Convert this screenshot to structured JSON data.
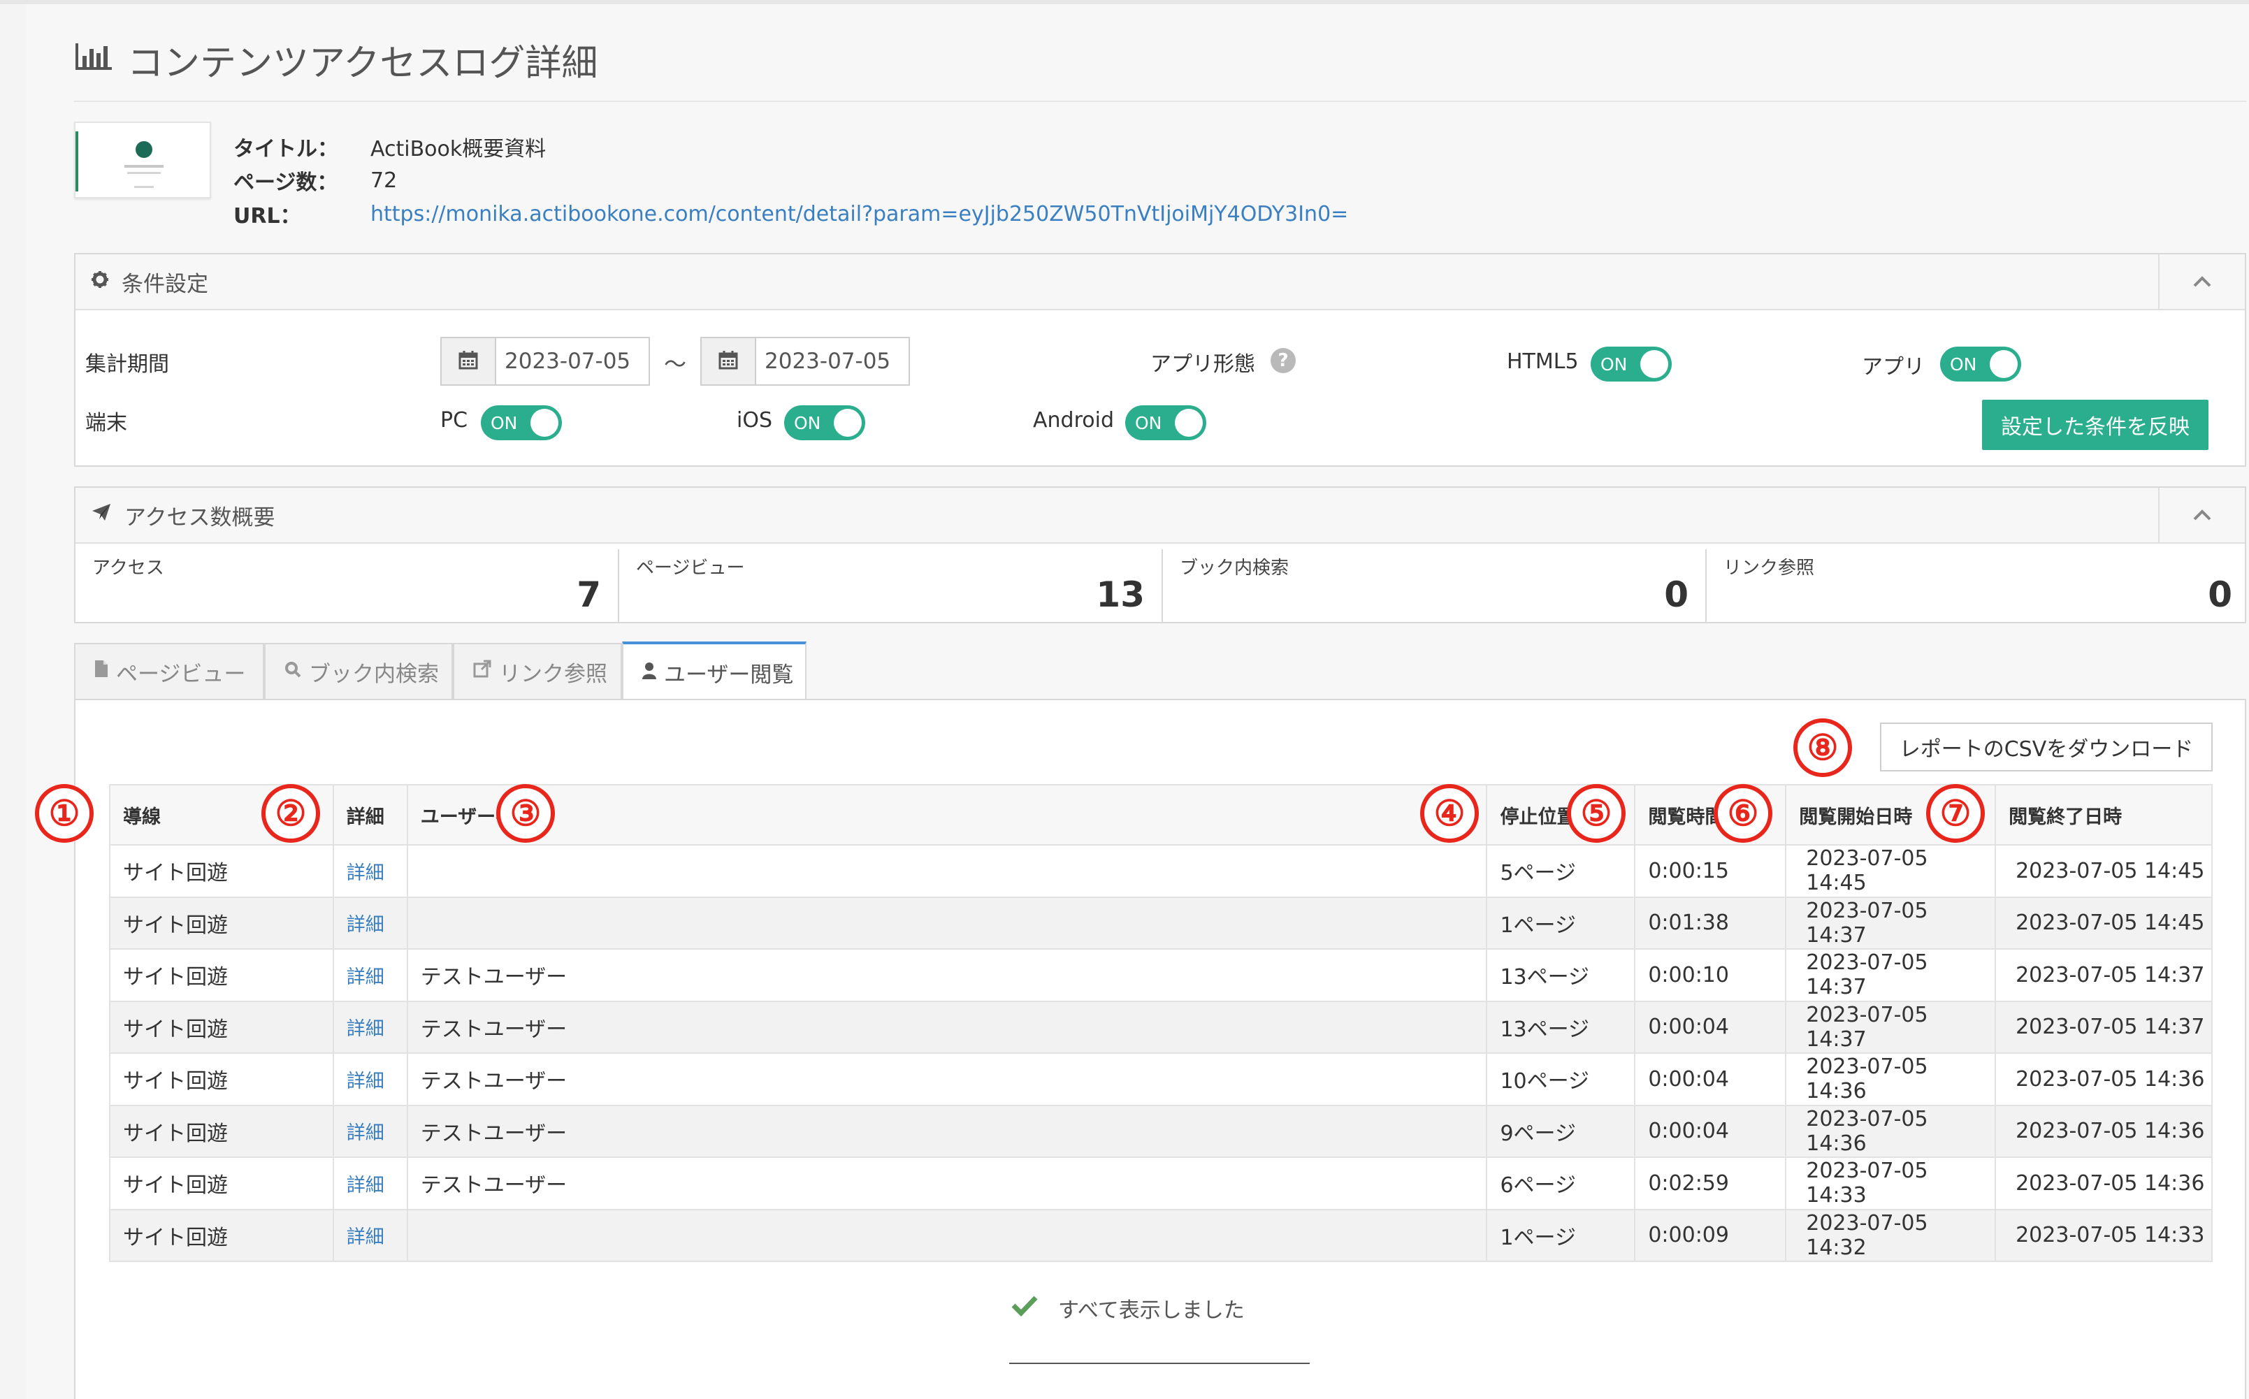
{
  "page": {
    "title": "コンテンツアクセスログ詳細"
  },
  "content_info": {
    "title_label": "タイトル：",
    "title_value": "ActiBook概要資料",
    "pages_label": "ページ数：",
    "pages_value": "72",
    "url_label": "URL：",
    "url_value": "https://monika.actibookone.com/content/detail?param=eyJjb250ZW50TnVtIjoiMjY4ODY3In0="
  },
  "conditions": {
    "header": "条件設定",
    "period_label": "集計期間",
    "date_from": "2023-07-05",
    "tilde": "～",
    "date_to": "2023-07-05",
    "app_form_label": "アプリ形態",
    "html5_label": "HTML5",
    "app_label": "アプリ",
    "device_label": "端末",
    "pc_label": "PC",
    "ios_label": "iOS",
    "android_label": "Android",
    "toggle_on": "ON",
    "apply_button": "設定した条件を反映"
  },
  "summary": {
    "header": "アクセス数概要",
    "stats": [
      {
        "label": "アクセス",
        "value": "7"
      },
      {
        "label": "ページビュー",
        "value": "13"
      },
      {
        "label": "ブック内検索",
        "value": "0"
      },
      {
        "label": "リンク参照",
        "value": "0"
      }
    ]
  },
  "tabs": [
    {
      "label": "ページビュー",
      "icon": "file-icon"
    },
    {
      "label": "ブック内検索",
      "icon": "search-icon"
    },
    {
      "label": "リンク参照",
      "icon": "external-link-icon"
    },
    {
      "label": "ユーザー閲覧",
      "icon": "user-icon",
      "active": true
    }
  ],
  "csv_button": "レポートのCSVをダウンロード",
  "table": {
    "columns": [
      "導線",
      "詳細",
      "ユーザー名",
      "停止位置",
      "閲覧時間",
      "閲覧開始日時",
      "閲覧終了日時"
    ],
    "rows": [
      [
        "サイト回遊",
        "詳細",
        "",
        "5ページ",
        "0:00:15",
        "2023-07-05 14:45",
        "2023-07-05 14:45"
      ],
      [
        "サイト回遊",
        "詳細",
        "",
        "1ページ",
        "0:01:38",
        "2023-07-05 14:37",
        "2023-07-05 14:45"
      ],
      [
        "サイト回遊",
        "詳細",
        "テストユーザー",
        "13ページ",
        "0:00:10",
        "2023-07-05 14:37",
        "2023-07-05 14:37"
      ],
      [
        "サイト回遊",
        "詳細",
        "テストユーザー",
        "13ページ",
        "0:00:04",
        "2023-07-05 14:37",
        "2023-07-05 14:37"
      ],
      [
        "サイト回遊",
        "詳細",
        "テストユーザー",
        "10ページ",
        "0:00:04",
        "2023-07-05 14:36",
        "2023-07-05 14:36"
      ],
      [
        "サイト回遊",
        "詳細",
        "テストユーザー",
        "9ページ",
        "0:00:04",
        "2023-07-05 14:36",
        "2023-07-05 14:36"
      ],
      [
        "サイト回遊",
        "詳細",
        "テストユーザー",
        "6ページ",
        "0:02:59",
        "2023-07-05 14:33",
        "2023-07-05 14:36"
      ],
      [
        "サイト回遊",
        "詳細",
        "",
        "1ページ",
        "0:00:09",
        "2023-07-05 14:32",
        "2023-07-05 14:33"
      ]
    ]
  },
  "annotations": [
    "①",
    "②",
    "③",
    "④",
    "⑤",
    "⑥",
    "⑦",
    "⑧"
  ],
  "footer": {
    "all_shown": "すべて表示しました"
  },
  "colors": {
    "accent": "#2aae8e",
    "link": "#3a7fc1",
    "annotation": "#e8261c"
  }
}
